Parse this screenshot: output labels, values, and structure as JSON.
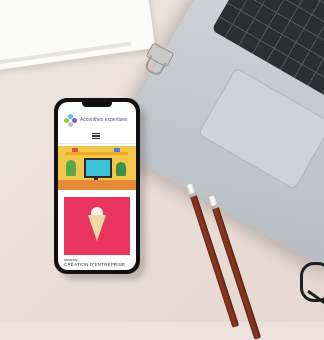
{
  "scene": {
    "background_color": "#ece1dc",
    "objects": [
      "notebook",
      "laptop",
      "binder-clip",
      "pencils",
      "glasses",
      "smartphone"
    ]
  },
  "phone": {
    "site": {
      "brand_name": "Accenthes expertises",
      "menu_icon": "hamburger-menu-icon"
    },
    "post": {
      "tag": "#startup",
      "caption": "CRÉATION D'ENTREPRISE",
      "image_color": "#e8345f"
    }
  },
  "colors": {
    "logo_dots": [
      "#9bc53d",
      "#5bc0eb",
      "#7a5cd6",
      "#c3c3c3"
    ]
  }
}
